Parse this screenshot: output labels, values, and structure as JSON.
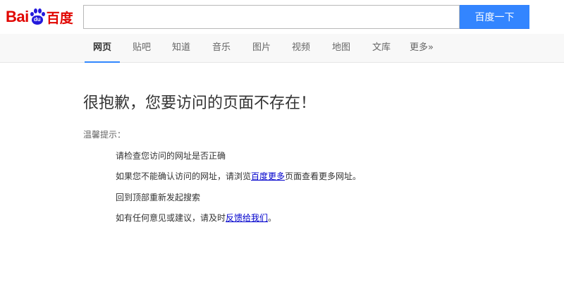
{
  "header": {
    "logo": {
      "part1": "Bai",
      "paw_text": "du",
      "part2": "百度"
    },
    "search": {
      "value": "",
      "placeholder": ""
    },
    "search_button": "百度一下"
  },
  "nav": {
    "items": [
      {
        "label": "网页",
        "active": true
      },
      {
        "label": "贴吧"
      },
      {
        "label": "知道"
      },
      {
        "label": "音乐"
      },
      {
        "label": "图片"
      },
      {
        "label": "视频"
      },
      {
        "label": "地图"
      },
      {
        "label": "文库"
      },
      {
        "label": "更多»"
      }
    ]
  },
  "error": {
    "title": "很抱歉，您要访问的页面不存在！",
    "tips_heading": "温馨提示：",
    "tips": {
      "check_url": "请检查您访问的网址是否正确",
      "browse_prefix": "如果您不能确认访问的网址，请浏览",
      "browse_link": "百度更多",
      "browse_suffix": "页面查看更多网址。",
      "back_home": "回到顶部重新发起搜索",
      "feedback_prefix": "如有任何意见或建议，请及时",
      "feedback_link": "反馈给我们",
      "feedback_suffix": "。"
    }
  },
  "colors": {
    "brand_red": "#e10601",
    "paw_blue": "#2319dc",
    "button_blue": "#3385ff",
    "link_blue": "#0000cc"
  }
}
